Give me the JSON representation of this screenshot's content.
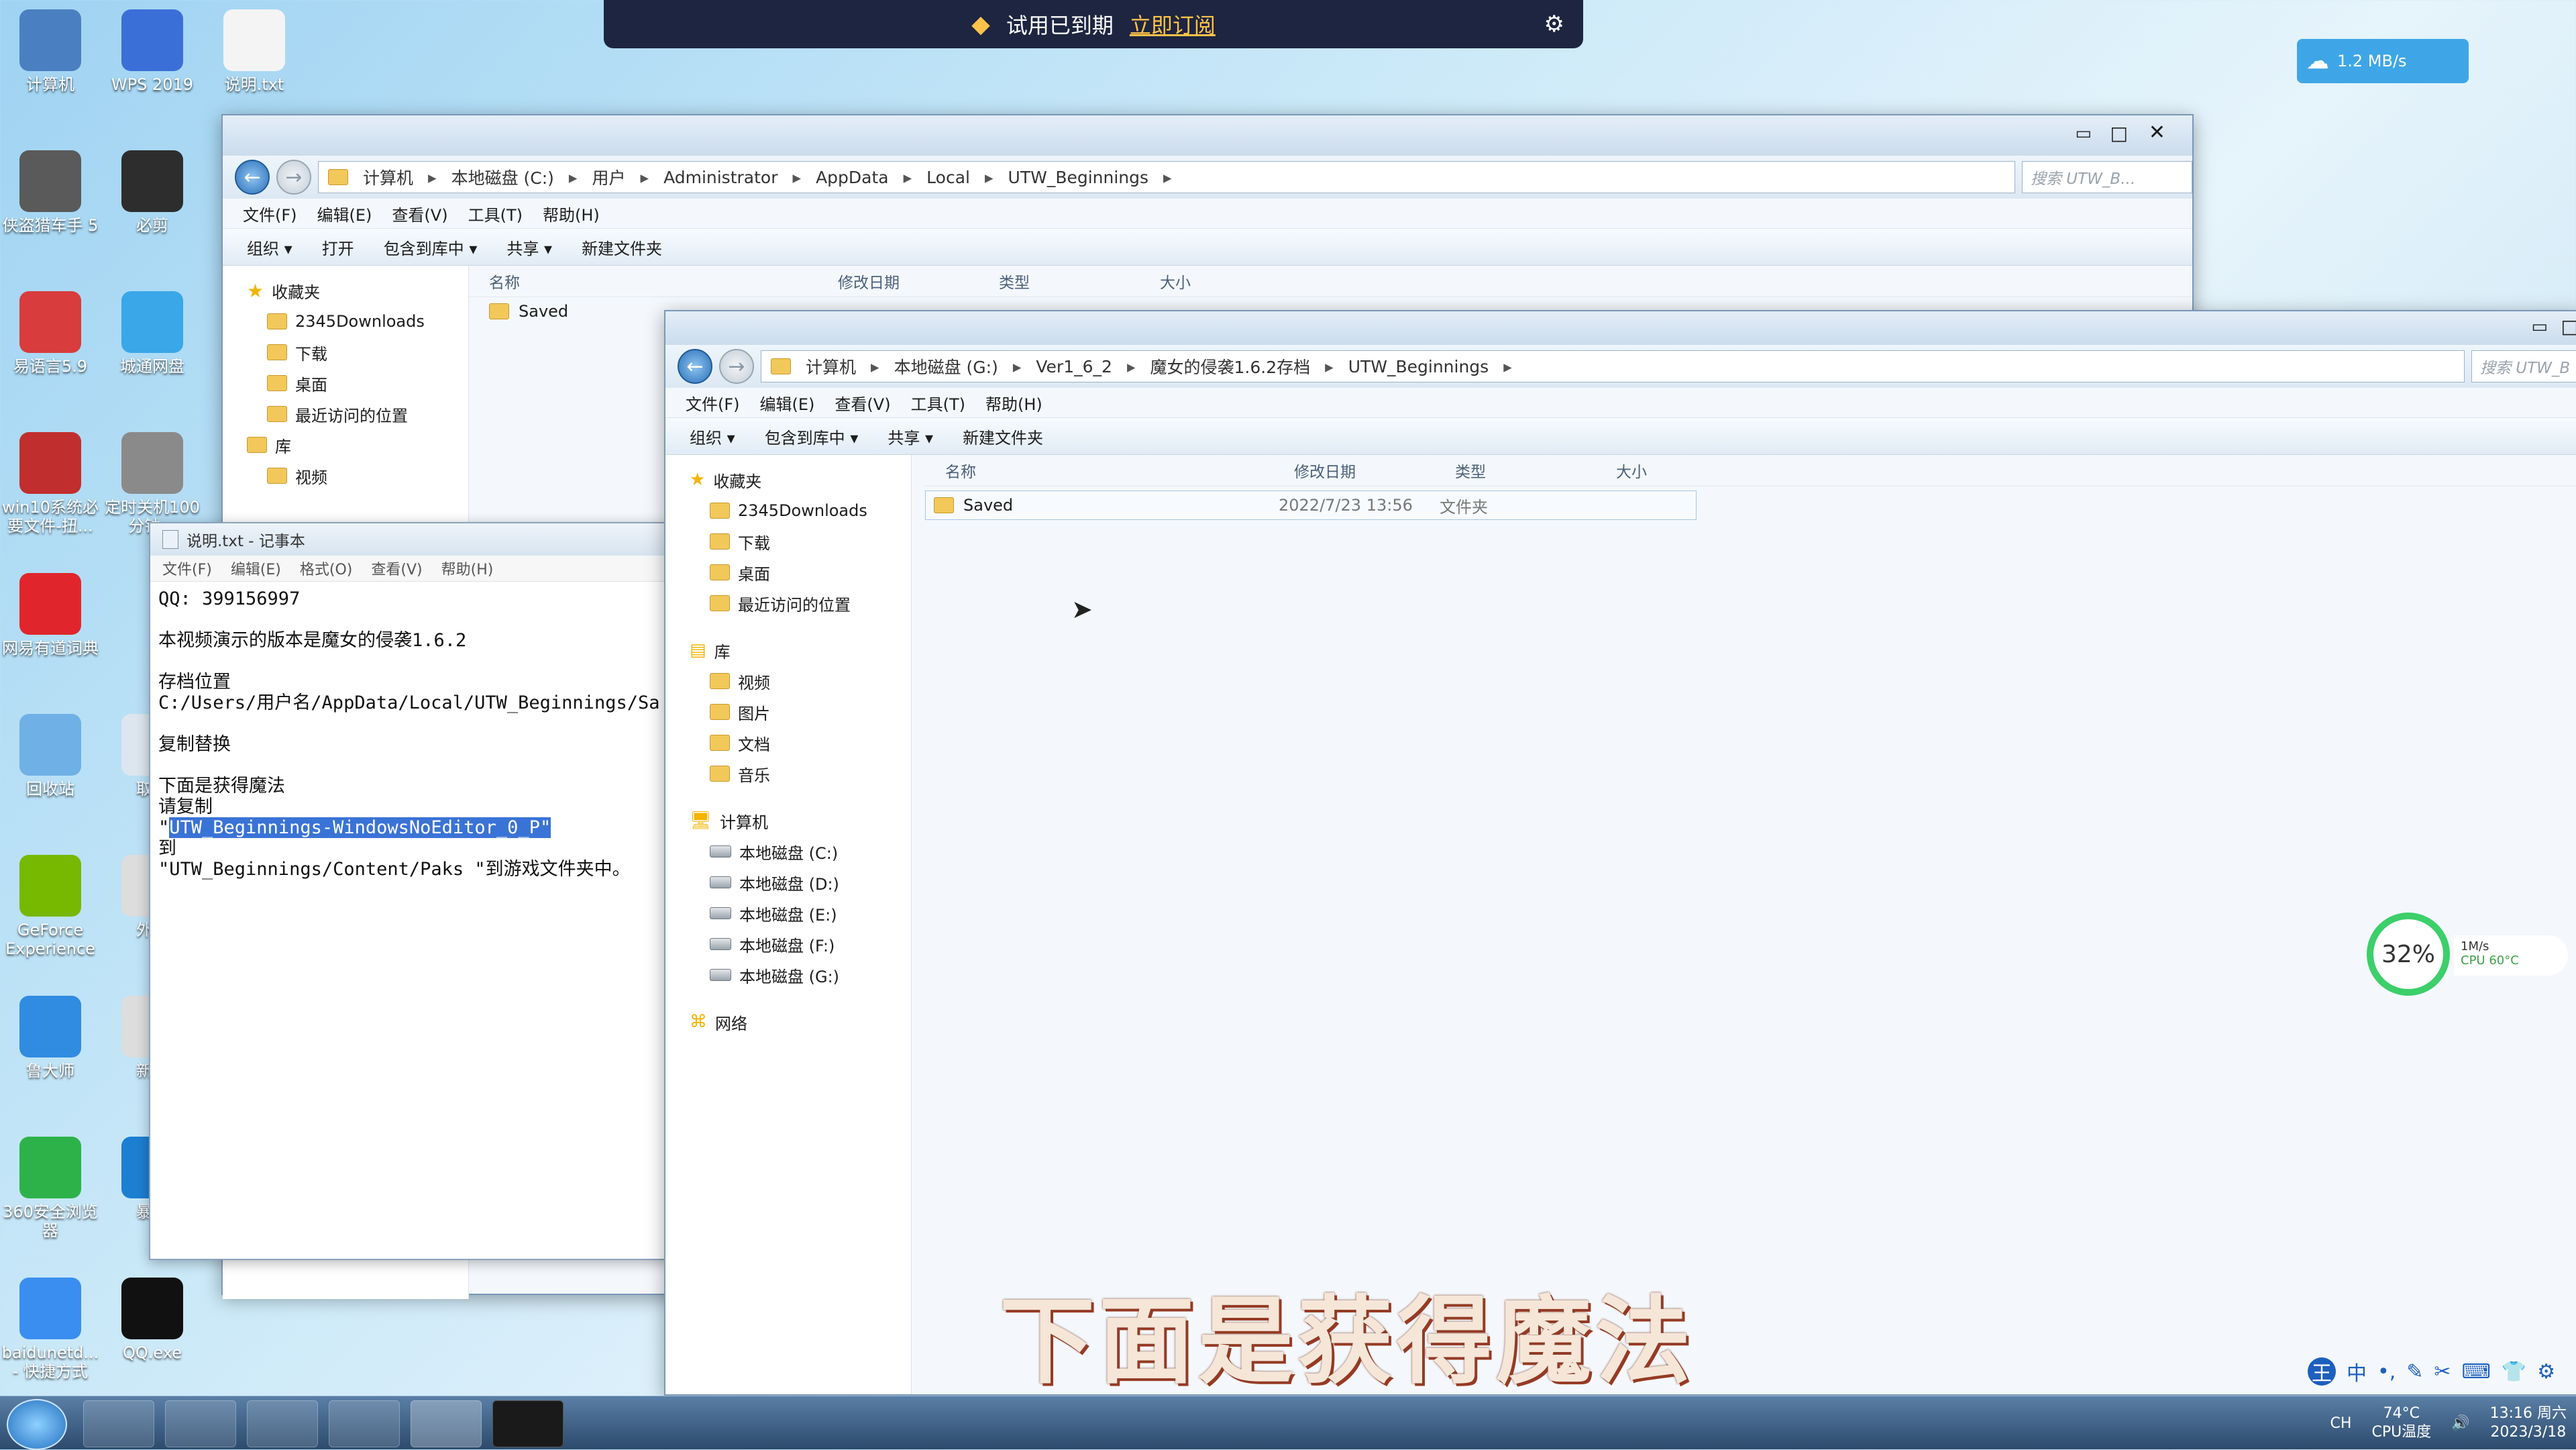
{
  "banner": {
    "text": "试用已到期",
    "subscribe": "立即订阅"
  },
  "net_widget": {
    "speed": "1.2 MB/s"
  },
  "desktop_icons": [
    {
      "label": "计算机",
      "color": "#4a7fc1"
    },
    {
      "label": "WPS 2019",
      "color": "#3b6fd8"
    },
    {
      "label": "说明.txt",
      "color": "#f4f4f4"
    },
    {
      "label": "侠盗猎车手 5",
      "color": "#5a5a5a"
    },
    {
      "label": "必剪",
      "color": "#2d2d2d"
    },
    {
      "label": "易语言5.9",
      "color": "#d83c3c"
    },
    {
      "label": "城通网盘",
      "color": "#39a7e8"
    },
    {
      "label": "win10系统必要文件-扭...",
      "color": "#c12e2e"
    },
    {
      "label": "定时关机100分钟...",
      "color": "#8a8a8a"
    },
    {
      "label": "网易有道词典",
      "color": "#e0262c"
    },
    {
      "label": "回收站",
      "color": "#6fb0e6"
    },
    {
      "label": "取消",
      "color": "#dde6ee"
    },
    {
      "label": "GeForce Experience",
      "color": "#76b900"
    },
    {
      "label": "外国",
      "color": "#ddd"
    },
    {
      "label": "鲁大师",
      "color": "#2f8ce0"
    },
    {
      "label": "新建",
      "color": "#ddd"
    },
    {
      "label": "360安全浏览器",
      "color": "#2db24a"
    },
    {
      "label": "暴风",
      "color": "#1c7fd1"
    },
    {
      "label": "baidunetd... - 快捷方式",
      "color": "#3a8ef0"
    },
    {
      "label": "QQ.exe",
      "color": "#111"
    }
  ],
  "explorer_back": {
    "path": [
      "计算机",
      "本地磁盘 (C:)",
      "用户",
      "Administrator",
      "AppData",
      "Local",
      "UTW_Beginnings"
    ],
    "search_placeholder": "搜索 UTW_B...",
    "menu": [
      "文件(F)",
      "编辑(E)",
      "查看(V)",
      "工具(T)",
      "帮助(H)"
    ],
    "toolbar": [
      "组织 ▾",
      "打开",
      "包含到库中 ▾",
      "共享 ▾",
      "新建文件夹"
    ],
    "nav": [
      "收藏夹",
      "2345Downloads",
      "下载",
      "桌面",
      "最近访问的位置",
      "库",
      "视频"
    ],
    "columns": [
      "名称",
      "修改日期",
      "类型",
      "大小"
    ],
    "files": [
      {
        "name": "Saved"
      }
    ]
  },
  "explorer_front": {
    "path": [
      "计算机",
      "本地磁盘 (G:)",
      "Ver1_6_2",
      "魔女的侵袭1.6.2存档",
      "UTW_Beginnings"
    ],
    "search_placeholder": "搜索 UTW_B",
    "menu": [
      "文件(F)",
      "编辑(E)",
      "查看(V)",
      "工具(T)",
      "帮助(H)"
    ],
    "toolbar": [
      "组织 ▾",
      "包含到库中 ▾",
      "共享 ▾",
      "新建文件夹"
    ],
    "nav": {
      "favorites": "收藏夹",
      "fav_items": [
        "2345Downloads",
        "下载",
        "桌面",
        "最近访问的位置"
      ],
      "library": "库",
      "lib_items": [
        "视频",
        "图片",
        "文档",
        "音乐"
      ],
      "computer": "计算机",
      "drives": [
        "本地磁盘 (C:)",
        "本地磁盘 (D:)",
        "本地磁盘 (E:)",
        "本地磁盘 (F:)",
        "本地磁盘 (G:)"
      ],
      "network": "网络"
    },
    "columns": [
      "名称",
      "修改日期",
      "类型",
      "大小"
    ],
    "files": [
      {
        "name": "Saved",
        "modified": "2022/7/23 13:56",
        "type": "文件夹"
      }
    ]
  },
  "notepad": {
    "title": "说明.txt - 记事本",
    "menu": [
      "文件(F)",
      "编辑(E)",
      "格式(O)",
      "查看(V)",
      "帮助(H)"
    ],
    "lines": [
      "QQ: 399156997",
      "",
      "本视频演示的版本是魔女的侵袭1.6.2",
      "",
      "存档位置",
      "C:/Users/用户名/AppData/Local/UTW_Beginnings/Sa",
      "",
      "复制替换",
      "",
      "下面是获得魔法",
      "请复制"
    ],
    "selected_line": "UTW_Beginnings-WindowsNoEditor_0_P\"",
    "after": [
      "到",
      "\"UTW_Beginnings/Content/Paks \"到游戏文件夹中。"
    ]
  },
  "cpu_widget": {
    "percent": "32%",
    "speed": "1M/s",
    "temp": "CPU 60°C"
  },
  "subtitle": "下面是获得魔法",
  "tray": {
    "time": "13:16 周六",
    "date": "2023/3/18",
    "cpu_temp": "74°C",
    "cpu_label": "CPU温度",
    "lang": "CH"
  }
}
